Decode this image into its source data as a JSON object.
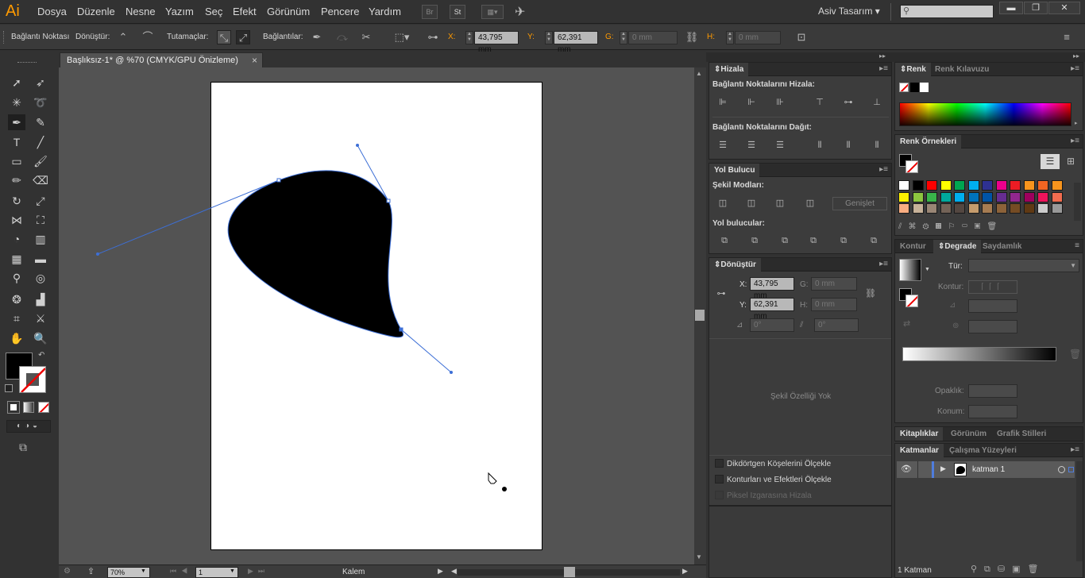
{
  "app": {
    "logo": "Ai",
    "workspace": "Asiv Tasarım",
    "bridge_label": "Br",
    "stock_label": "St"
  },
  "menus": [
    "Dosya",
    "Düzenle",
    "Nesne",
    "Yazım",
    "Seç",
    "Efekt",
    "Görünüm",
    "Pencere",
    "Yardım"
  ],
  "control": {
    "anchor_label": "Bağlantı Noktası",
    "convert_label": "Dönüştür:",
    "handles_label": "Tutamaçlar:",
    "anchors_label": "Bağlantılar:",
    "x_label": "X:",
    "x_value": "43,795 mm",
    "y_label": "Y:",
    "y_value": "62,391 mm",
    "w_label": "G:",
    "w_value": "0 mm",
    "h_label": "H:",
    "h_value": "0 mm"
  },
  "document": {
    "tab_title": "Başlıksız-1* @ %70 (CMYK/GPU Önizleme)",
    "close": "×"
  },
  "status": {
    "zoom": "70%",
    "page": "1",
    "tool": "Kalem"
  },
  "align_panel": {
    "title": "Hizala",
    "align_anchors": "Bağlantı Noktalarını Hizala:",
    "distribute_anchors": "Bağlantı Noktalarını Dağıt:"
  },
  "pathfinder_panel": {
    "title": "Yol Bulucu",
    "shape_modes": "Şekil Modları:",
    "expand": "Genişlet",
    "pathfinders": "Yol bulucular:"
  },
  "transform_panel": {
    "title": "Dönüştür",
    "x_label": "X:",
    "x_value": "43,795 mm",
    "y_label": "Y:",
    "y_value": "62,391 mm",
    "w_label": "G:",
    "w_value": "0 mm",
    "h_label": "H:",
    "h_value": "0 mm",
    "angle_value": "0°",
    "shear_value": "0°",
    "no_shape": "Şekil Özelliği Yok",
    "opt1": "Dikdörtgen Köşelerini Ölçekle",
    "opt2": "Konturları ve Efektleri Ölçekle",
    "opt3": "Piksel Izgarasına Hizala"
  },
  "color_panel": {
    "tab1": "Renk",
    "tab2": "Renk Kılavuzu"
  },
  "swatches_panel": {
    "title": "Renk Örnekleri"
  },
  "swatch_colors": [
    "#ffffff",
    "#000000",
    "#ff0000",
    "#ffff00",
    "#00a651",
    "#00aeef",
    "#2e3192",
    "#ec008c",
    "#ed1c24",
    "#f7941d",
    "#f26522",
    "#f7941d",
    "#fff200",
    "#8dc63f",
    "#39b54a",
    "#00a99d",
    "#00aeef",
    "#0072bc",
    "#0054a6",
    "#662d91",
    "#92278f",
    "#9e005d",
    "#ed145b",
    "#f26c4f",
    "#f9ad81",
    "#c7b299",
    "#998675",
    "#736357",
    "#534741",
    "#c69c6d",
    "#a67c52",
    "#8c6239",
    "#754c24",
    "#603913",
    "#cccccc",
    "#999999"
  ],
  "gradient_panel": {
    "tab1": "Kontur",
    "tab2": "Degrade",
    "tab3": "Saydamlık",
    "type_label": "Tür:",
    "stroke_label": "Kontur:",
    "opacity_label": "Opaklık:",
    "position_label": "Konum:"
  },
  "libraries_panel": {
    "tab1": "Kitaplıklar",
    "tab2": "Görünüm",
    "tab3": "Grafik Stilleri"
  },
  "layers_panel": {
    "tab1": "Katmanlar",
    "tab2": "Çalışma Yüzeyleri",
    "layer_name": "katman 1",
    "footer": "1 Katman"
  }
}
